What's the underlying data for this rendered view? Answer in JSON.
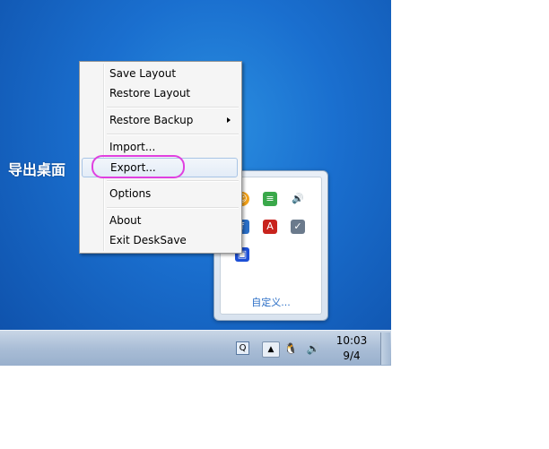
{
  "annotation": {
    "label": "导出桌面"
  },
  "menu": {
    "items": [
      {
        "label": "Save Layout"
      },
      {
        "label": "Restore Layout"
      },
      {
        "label": "Restore Backup"
      },
      {
        "label": "Import..."
      },
      {
        "label": "Export..."
      },
      {
        "label": "Options"
      },
      {
        "label": "About"
      },
      {
        "label": "Exit DeskSave"
      }
    ],
    "selected_index": 4
  },
  "tray_flyout": {
    "customize_link": "自定义..."
  },
  "taskbar": {
    "clock": {
      "time": "10:03",
      "date": "9/4"
    }
  },
  "colors": {
    "highlight_ellipse": "#e040e0",
    "desktop_blue": "#1a6fcf",
    "link_blue": "#2a6ec6"
  }
}
